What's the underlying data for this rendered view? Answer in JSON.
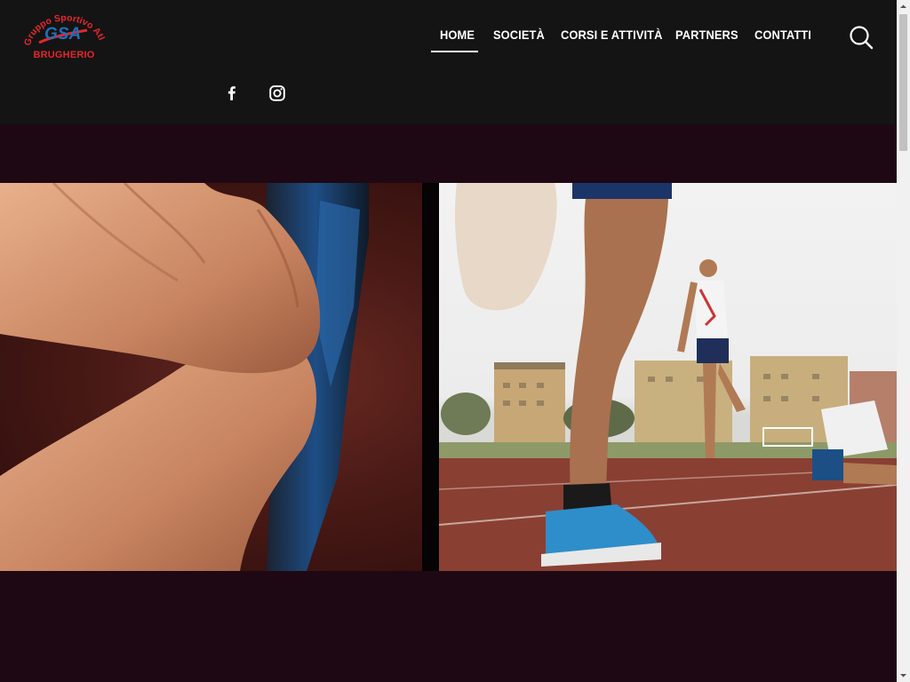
{
  "brand": {
    "logo_mark": "GSA",
    "logo_arc_text": "Gruppo Sportivo Atletica",
    "logo_caption": "BRUGHERIO",
    "colors": {
      "red": "#e4262b",
      "blue": "#1f6fb8"
    }
  },
  "nav": {
    "items": [
      {
        "label": "HOME",
        "active": true
      },
      {
        "label": "SOCIETÀ",
        "active": false
      },
      {
        "label": "CORSI E ATTIVITÀ",
        "active": false
      },
      {
        "label": "PARTNERS",
        "active": false
      },
      {
        "label": "CONTATTI",
        "active": false
      }
    ],
    "search_icon": "search-icon"
  },
  "social": {
    "items": [
      {
        "icon": "facebook-icon"
      },
      {
        "icon": "instagram-icon"
      }
    ]
  },
  "hero": {
    "left_image": "hand-stretching-shoe-photo",
    "right_image": "athletes-warming-up-on-track-photo",
    "background": "#1e0814"
  }
}
